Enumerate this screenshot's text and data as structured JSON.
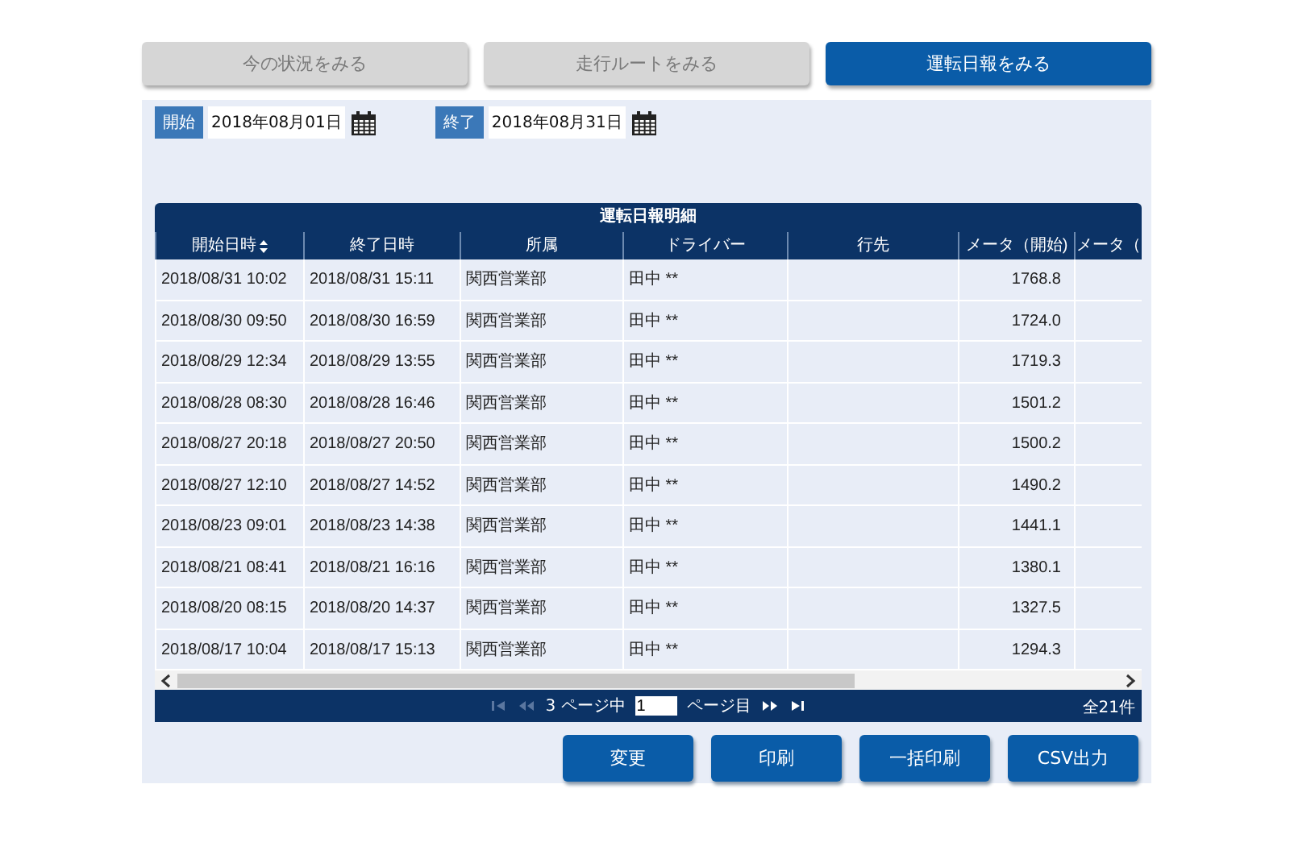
{
  "tabs": [
    {
      "label": "今の状況をみる",
      "selected": false
    },
    {
      "label": "走行ルートをみる",
      "selected": false
    },
    {
      "label": "運転日報をみる",
      "selected": true
    }
  ],
  "filters": [
    {
      "label": "開始",
      "value": "2018年08月01日"
    },
    {
      "label": "終了",
      "value": "2018年08月31日"
    }
  ],
  "table": {
    "title": "運転日報明細",
    "columns": [
      {
        "label": "開始日時",
        "sorted": true
      },
      {
        "label": "終了日時",
        "sorted": false
      },
      {
        "label": "所属",
        "sorted": false
      },
      {
        "label": "ドライバー",
        "sorted": false
      },
      {
        "label": "行先",
        "sorted": false
      },
      {
        "label": "メータ（開始)",
        "sorted": false
      },
      {
        "label": "メータ（",
        "sorted": false
      }
    ],
    "rows": [
      [
        "2018/08/31 10:02",
        "2018/08/31 15:11",
        "関西営業部",
        "田中 **",
        "",
        "1768.8",
        ""
      ],
      [
        "2018/08/30 09:50",
        "2018/08/30 16:59",
        "関西営業部",
        "田中 **",
        "",
        "1724.0",
        ""
      ],
      [
        "2018/08/29 12:34",
        "2018/08/29 13:55",
        "関西営業部",
        "田中 **",
        "",
        "1719.3",
        ""
      ],
      [
        "2018/08/28 08:30",
        "2018/08/28 16:46",
        "関西営業部",
        "田中 **",
        "",
        "1501.2",
        ""
      ],
      [
        "2018/08/27 20:18",
        "2018/08/27 20:50",
        "関西営業部",
        "田中 **",
        "",
        "1500.2",
        ""
      ],
      [
        "2018/08/27 12:10",
        "2018/08/27 14:52",
        "関西営業部",
        "田中 **",
        "",
        "1490.2",
        ""
      ],
      [
        "2018/08/23 09:01",
        "2018/08/23 14:38",
        "関西営業部",
        "田中 **",
        "",
        "1441.1",
        ""
      ],
      [
        "2018/08/21 08:41",
        "2018/08/21 16:16",
        "関西営業部",
        "田中 **",
        "",
        "1380.1",
        ""
      ],
      [
        "2018/08/20 08:15",
        "2018/08/20 14:37",
        "関西営業部",
        "田中 **",
        "",
        "1327.5",
        ""
      ],
      [
        "2018/08/17 10:04",
        "2018/08/17 15:13",
        "関西営業部",
        "田中 **",
        "",
        "1294.3",
        ""
      ]
    ]
  },
  "pager": {
    "first_disabled": true,
    "prev_disabled": true,
    "pages_text": "3 ページ中",
    "page": "1",
    "page_suffix": "ページ目",
    "total": "全21件"
  },
  "buttons": [
    "変更",
    "印刷",
    "一括印刷",
    "CSV出力"
  ]
}
